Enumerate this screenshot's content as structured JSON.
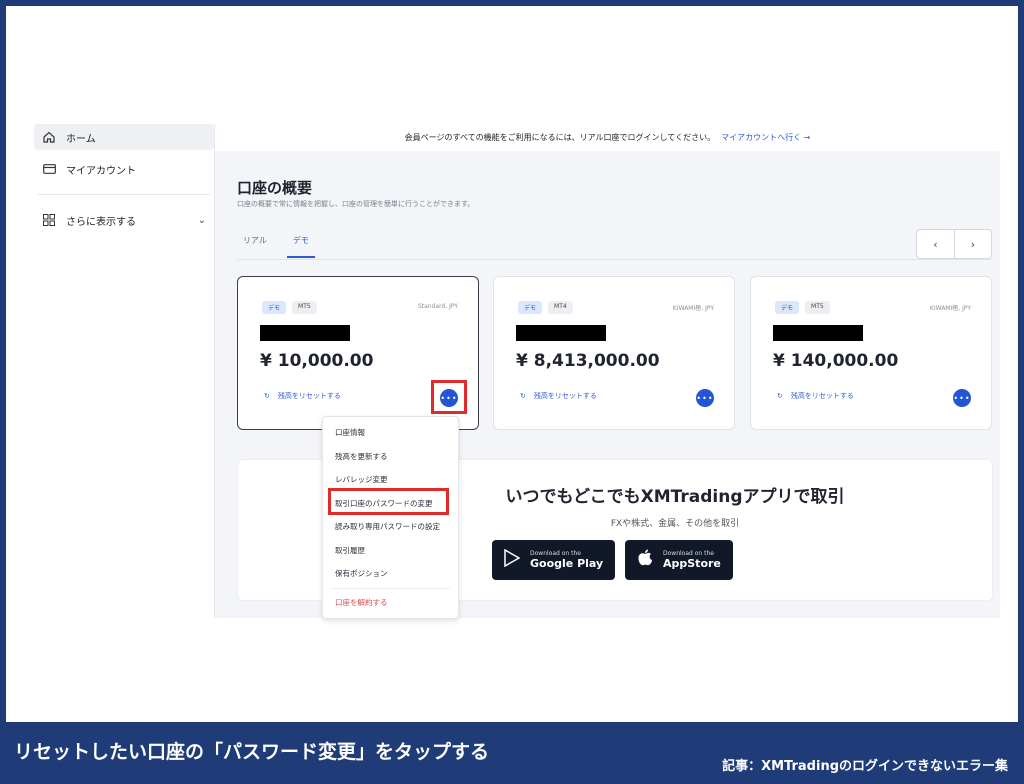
{
  "sidebar": {
    "home_label": "ホーム",
    "account_label": "マイアカウント",
    "more_label": "さらに表示する"
  },
  "banner": {
    "text": "会員ページのすべての機能をご利用になるには、リアル口座でログインしてください。",
    "link": "マイアカウントへ行く →"
  },
  "header": {
    "title": "口座の概要",
    "subtitle": "口座の概要で常に情報を把握し、口座の管理を簡単に行うことができます。"
  },
  "tabs": [
    "リアル",
    "デモ"
  ],
  "pager": {
    "prev": "‹",
    "next": "›"
  },
  "accounts": [
    {
      "badge": "デモ",
      "platform": "MT5",
      "type": "Standard, JPY",
      "balance": "¥ 10,000.00",
      "reset": "残高をリセットする"
    },
    {
      "badge": "デモ",
      "platform": "MT4",
      "type": "KIWAMI極, JPY",
      "balance": "¥ 8,413,000.00",
      "reset": "残高をリセットする"
    },
    {
      "badge": "デモ",
      "platform": "MT5",
      "type": "KIWAMI極, JPY",
      "balance": "¥ 140,000.00",
      "reset": "残高をリセットする"
    }
  ],
  "menu": {
    "items": [
      "口座情報",
      "残高を更新する",
      "レバレッジ変更",
      "取引口座のパスワードの変更",
      "読み取り専用パスワードの設定",
      "取引履歴",
      "保有ポジション"
    ],
    "danger": "口座を解約する"
  },
  "promo": {
    "title": "いつでもどこでもXMTradingアプリで取引",
    "subtitle": "FXや株式、金属、その他を取引",
    "google_small": "Download on the",
    "google_big": "Google Play",
    "apple_small": "Download on the",
    "apple_big": "AppStore"
  },
  "caption": {
    "main": "リセットしたい口座の「パスワード変更」をタップする",
    "source": "記事：XMTradingのログインできないエラー集"
  },
  "colors": {
    "accent": "#2d5bd6",
    "highlight": "#e02b2b",
    "frame": "#1f3c78"
  }
}
